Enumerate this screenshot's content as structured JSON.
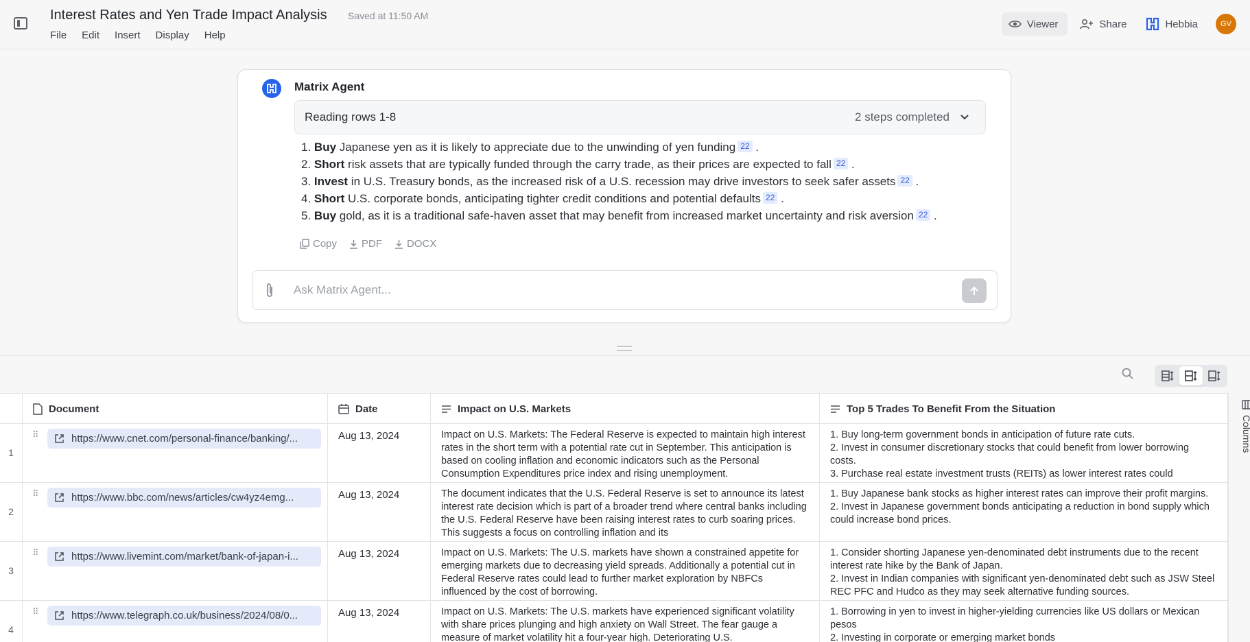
{
  "header": {
    "title": "Interest Rates and Yen Trade Impact Analysis",
    "saved": "Saved at 11:50 AM",
    "menu": [
      "File",
      "Edit",
      "Insert",
      "Display",
      "Help"
    ],
    "viewer_label": "Viewer",
    "share_label": "Share",
    "hebbia_label": "Hebbia",
    "avatar_initials": "GV"
  },
  "agent": {
    "name": "Matrix Agent",
    "steps_label": "Reading rows 1-8",
    "steps_status": "2 steps completed",
    "answers": [
      {
        "num": "1.",
        "bold": "Buy",
        "text": " Japanese yen as it is likely to appreciate due to the unwinding of yen funding",
        "cite": "22"
      },
      {
        "num": "2.",
        "bold": "Short",
        "text": " risk assets that are typically funded through the carry trade, as their prices are expected to fall",
        "cite": "22"
      },
      {
        "num": "3.",
        "bold": "Invest",
        "text": " in U.S. Treasury bonds, as the increased risk of a U.S. recession may drive investors to seek safer assets",
        "cite": "22"
      },
      {
        "num": "4.",
        "bold": "Short",
        "text": " U.S. corporate bonds, anticipating tighter credit conditions and potential defaults",
        "cite": "22"
      },
      {
        "num": "5.",
        "bold": "Buy",
        "text": " gold, as it is a traditional safe-haven asset that may benefit from increased market uncertainty and risk aversion",
        "cite": "22"
      }
    ],
    "export": {
      "copy": "Copy",
      "pdf": "PDF",
      "docx": "DOCX"
    },
    "ask_placeholder": "Ask Matrix Agent..."
  },
  "table": {
    "columns": {
      "document": "Document",
      "date": "Date",
      "impact": "Impact on U.S. Markets",
      "trades": "Top 5 Trades To Benefit From the Situation"
    },
    "rows": [
      {
        "num": "1",
        "url": "https://www.cnet.com/personal-finance/banking/...",
        "date": "Aug 13, 2024",
        "impact": "Impact on U.S. Markets: The Federal Reserve is expected to maintain high interest rates in the short term with a potential rate cut in September. This anticipation is based on cooling inflation and economic indicators such as the Personal Consumption Expenditures price index and rising unemployment.",
        "trades": [
          "1. Buy long-term government bonds in anticipation of future rate cuts.",
          "2. Invest in consumer discretionary stocks that could benefit from lower borrowing costs.",
          "3. Purchase real estate investment trusts (REITs) as lower interest rates could"
        ]
      },
      {
        "num": "2",
        "url": "https://www.bbc.com/news/articles/cw4yz4emg...",
        "date": "Aug 13, 2024",
        "impact": "The document indicates that the U.S. Federal Reserve is set to announce its latest interest rate decision which is part of a broader trend where central banks including the U.S. Federal Reserve have been raising interest rates to curb soaring prices. This suggests a focus on controlling inflation and its",
        "trades": [
          "1. Buy Japanese bank stocks as higher interest rates can improve their profit margins.",
          "2. Invest in Japanese government bonds anticipating a reduction in bond supply which could increase bond prices."
        ]
      },
      {
        "num": "3",
        "url": "https://www.livemint.com/market/bank-of-japan-i...",
        "date": "Aug 13, 2024",
        "impact": "Impact on U.S. Markets: The U.S. markets have shown a constrained appetite for emerging markets due to decreasing yield spreads. Additionally a potential cut in Federal Reserve rates could lead to further market exploration by NBFCs influenced by the cost of borrowing.",
        "trades": [
          "1. Consider shorting Japanese yen-denominated debt instruments due to the recent interest rate hike by the Bank of Japan.",
          "2. Invest in Indian companies with significant yen-denominated debt such as JSW Steel REC PFC and Hudco as they may seek alternative funding sources."
        ]
      },
      {
        "num": "4",
        "url": "https://www.telegraph.co.uk/business/2024/08/0...",
        "date": "Aug 13, 2024",
        "impact": "Impact on U.S. Markets: The U.S. markets have experienced significant volatility with share prices plunging and high anxiety on Wall Street. The fear gauge a measure of market volatility hit a four-year high. Deteriorating U.S.",
        "trades": [
          "1. Borrowing in yen to invest in higher-yielding currencies like US dollars or Mexican pesos",
          "2. Investing in corporate or emerging market bonds"
        ]
      }
    ]
  },
  "columns_panel_label": "Columns"
}
